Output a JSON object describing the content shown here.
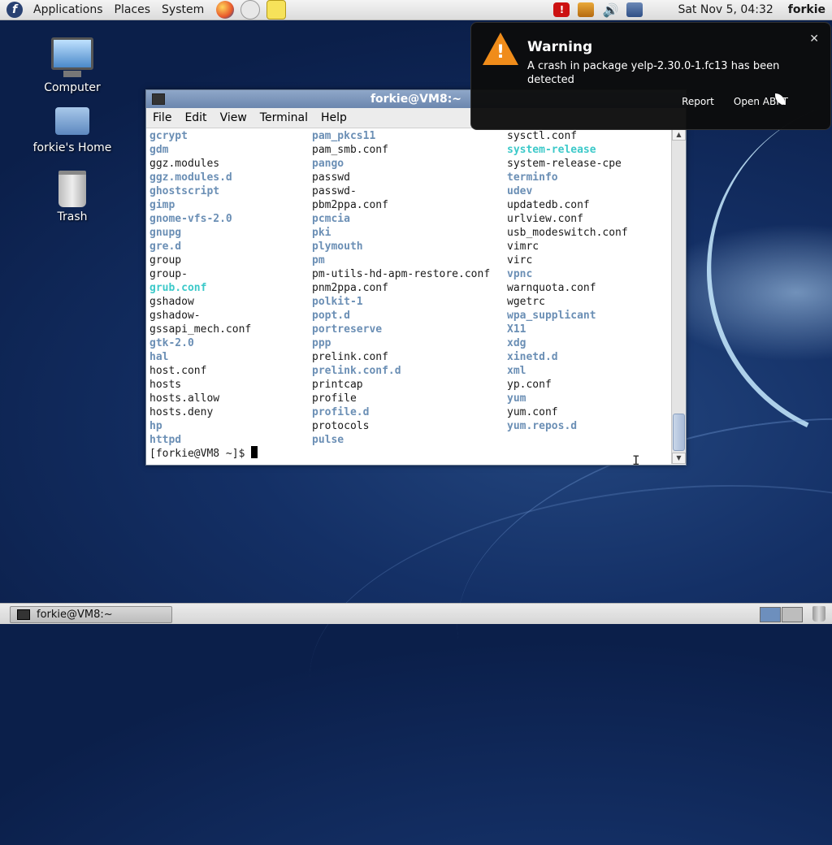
{
  "top_panel": {
    "menus": [
      "Applications",
      "Places",
      "System"
    ],
    "clock": "Sat Nov  5, 04:32",
    "user": "forkie"
  },
  "desktop": {
    "icons": [
      "Computer",
      "forkie's Home",
      "Trash"
    ]
  },
  "terminal": {
    "title": "forkie@VM8:~",
    "menu": [
      "File",
      "Edit",
      "View",
      "Terminal",
      "Help"
    ],
    "col1": [
      {
        "t": "gcrypt",
        "k": "dir"
      },
      {
        "t": "gdm",
        "k": "dir"
      },
      {
        "t": "ggz.modules",
        "k": "file"
      },
      {
        "t": "ggz.modules.d",
        "k": "dir"
      },
      {
        "t": "ghostscript",
        "k": "dir"
      },
      {
        "t": "gimp",
        "k": "dir"
      },
      {
        "t": "gnome-vfs-2.0",
        "k": "dir"
      },
      {
        "t": "gnupg",
        "k": "dir"
      },
      {
        "t": "gre.d",
        "k": "dir"
      },
      {
        "t": "group",
        "k": "file"
      },
      {
        "t": "group-",
        "k": "file"
      },
      {
        "t": "grub.conf",
        "k": "link"
      },
      {
        "t": "gshadow",
        "k": "file"
      },
      {
        "t": "gshadow-",
        "k": "file"
      },
      {
        "t": "gssapi_mech.conf",
        "k": "file"
      },
      {
        "t": "gtk-2.0",
        "k": "dir"
      },
      {
        "t": "hal",
        "k": "dir"
      },
      {
        "t": "host.conf",
        "k": "file"
      },
      {
        "t": "hosts",
        "k": "file"
      },
      {
        "t": "hosts.allow",
        "k": "file"
      },
      {
        "t": "hosts.deny",
        "k": "file"
      },
      {
        "t": "hp",
        "k": "dir"
      },
      {
        "t": "httpd",
        "k": "dir"
      }
    ],
    "col2": [
      {
        "t": "pam_pkcs11",
        "k": "dir"
      },
      {
        "t": "pam_smb.conf",
        "k": "file"
      },
      {
        "t": "pango",
        "k": "dir"
      },
      {
        "t": "passwd",
        "k": "file"
      },
      {
        "t": "passwd-",
        "k": "file"
      },
      {
        "t": "pbm2ppa.conf",
        "k": "file"
      },
      {
        "t": "pcmcia",
        "k": "dir"
      },
      {
        "t": "pki",
        "k": "dir"
      },
      {
        "t": "plymouth",
        "k": "dir"
      },
      {
        "t": "pm",
        "k": "dir"
      },
      {
        "t": "pm-utils-hd-apm-restore.conf",
        "k": "file"
      },
      {
        "t": "pnm2ppa.conf",
        "k": "file"
      },
      {
        "t": "polkit-1",
        "k": "dir"
      },
      {
        "t": "popt.d",
        "k": "dir"
      },
      {
        "t": "portreserve",
        "k": "dir"
      },
      {
        "t": "ppp",
        "k": "dir"
      },
      {
        "t": "prelink.conf",
        "k": "file"
      },
      {
        "t": "prelink.conf.d",
        "k": "dir"
      },
      {
        "t": "printcap",
        "k": "file"
      },
      {
        "t": "profile",
        "k": "file"
      },
      {
        "t": "profile.d",
        "k": "dir"
      },
      {
        "t": "protocols",
        "k": "file"
      },
      {
        "t": "pulse",
        "k": "dir"
      }
    ],
    "col3": [
      {
        "t": "sysctl.conf",
        "k": "file"
      },
      {
        "t": "system-release",
        "k": "link"
      },
      {
        "t": "system-release-cpe",
        "k": "file"
      },
      {
        "t": "terminfo",
        "k": "dir"
      },
      {
        "t": "udev",
        "k": "dir"
      },
      {
        "t": "updatedb.conf",
        "k": "file"
      },
      {
        "t": "urlview.conf",
        "k": "file"
      },
      {
        "t": "usb_modeswitch.conf",
        "k": "file"
      },
      {
        "t": "vimrc",
        "k": "file"
      },
      {
        "t": "virc",
        "k": "file"
      },
      {
        "t": "vpnc",
        "k": "dir"
      },
      {
        "t": "warnquota.conf",
        "k": "file"
      },
      {
        "t": "wgetrc",
        "k": "file"
      },
      {
        "t": "wpa_supplicant",
        "k": "dir"
      },
      {
        "t": "X11",
        "k": "dir"
      },
      {
        "t": "xdg",
        "k": "dir"
      },
      {
        "t": "xinetd.d",
        "k": "dir"
      },
      {
        "t": "xml",
        "k": "dir"
      },
      {
        "t": "yp.conf",
        "k": "file"
      },
      {
        "t": "yum",
        "k": "dir"
      },
      {
        "t": "yum.conf",
        "k": "file"
      },
      {
        "t": "yum.repos.d",
        "k": "dir"
      }
    ],
    "prompt": "[forkie@VM8 ~]$ "
  },
  "notification": {
    "title": "Warning",
    "body": "A crash in package yelp-2.30.0-1.fc13 has been detected",
    "actions": [
      "Report",
      "Open ABRT"
    ]
  },
  "taskbar": {
    "window_button": "forkie@VM8:~"
  },
  "colors": {
    "dir": "#6b8fb5",
    "link": "#3cc9c9",
    "warning": "#f08c1a"
  }
}
